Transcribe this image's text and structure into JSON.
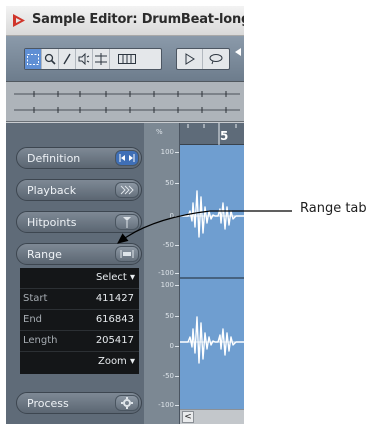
{
  "window": {
    "title": "Sample Editor: DrumBeat-long"
  },
  "toolbar": {
    "tools": [
      {
        "icon": "range-selection-icon",
        "active": true
      },
      {
        "icon": "zoom-icon"
      },
      {
        "icon": "pencil-icon"
      },
      {
        "icon": "speaker-icon"
      },
      {
        "icon": "scrub-icon"
      },
      {
        "icon": "time-warp-icon"
      },
      {
        "icon": "play-icon"
      },
      {
        "icon": "loop-icon"
      }
    ]
  },
  "inspector": {
    "definition_label": "Definition",
    "playback_label": "Playback",
    "hitpoints_label": "Hitpoints",
    "range_label": "Range",
    "process_label": "Process",
    "range_panel": {
      "select_label": "Select",
      "start_label": "Start",
      "start_value": "411427",
      "end_label": "End",
      "end_value": "616843",
      "length_label": "Length",
      "length_value": "205417",
      "zoom_label": "Zoom"
    }
  },
  "scale": {
    "unit": "%",
    "upper": [
      "100",
      "50",
      "0",
      "-50",
      "-100"
    ],
    "lower": [
      "100",
      "50",
      "0",
      "-50",
      "-100"
    ]
  },
  "ruler": {
    "bar_number": "5"
  },
  "callout": {
    "text": "Range tab"
  },
  "colors": {
    "waveform_bg": "#6f9ed0",
    "inspector_bg": "#5f6b78",
    "logo": "#d0352b"
  }
}
